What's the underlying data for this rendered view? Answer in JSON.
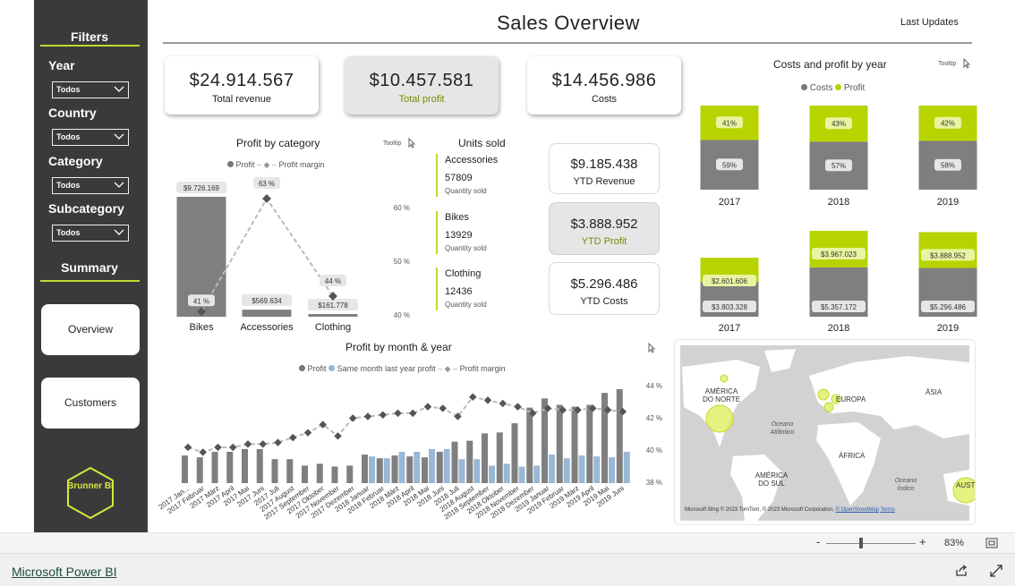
{
  "header": {
    "title": "Sales Overview",
    "last_updates": "Last Updates"
  },
  "sidebar": {
    "filters_title": "Filters",
    "filters": [
      {
        "label": "Year",
        "value": "Todos"
      },
      {
        "label": "Country",
        "value": "Todos"
      },
      {
        "label": "Category",
        "value": "Todos"
      },
      {
        "label": "Subcategory",
        "value": "Todos"
      }
    ],
    "summary_title": "Summary",
    "nav": [
      {
        "label": "Overview"
      },
      {
        "label": "Customers"
      }
    ],
    "logo_text": "Brunner BI"
  },
  "kpis": [
    {
      "value": "$24.914.567",
      "label": "Total revenue"
    },
    {
      "value": "$10.457.581",
      "label": "Total profit"
    },
    {
      "value": "$14.456.986",
      "label": "Costs"
    }
  ],
  "ytd": [
    {
      "value": "$9.185.438",
      "label": "YTD Revenue"
    },
    {
      "value": "$3.888.952",
      "label": "YTD Profit"
    },
    {
      "value": "$5.296.486",
      "label": "YTD Costs"
    }
  ],
  "units_sold": {
    "title": "Units sold",
    "sub_label": "Quantity sold",
    "items": [
      {
        "name": "Accessories",
        "qty": "57809"
      },
      {
        "name": "Bikes",
        "qty": "13929"
      },
      {
        "name": "Clothing",
        "qty": "12436"
      }
    ]
  },
  "tooltip_label": "Tooltip",
  "map": {
    "labels": [
      "AMÉRICA DO NORTE",
      "EUROPA",
      "ÁSIA",
      "Oceano Atlântico",
      "ÁFRICA",
      "AMÉRICA DO SUL",
      "Oceano Índico",
      "AUST"
    ],
    "attribution": "© 2023 TomTom, © 2023 Microsoft Corporation,",
    "osm_link": "© OpenStreetMap",
    "terms_link": "Terms",
    "bing": "Microsoft Bing"
  },
  "footer": {
    "brand": "Microsoft Power BI",
    "zoom_minus": "-",
    "zoom_plus": "+",
    "zoom": "83%"
  },
  "colors": {
    "sidebar": "#3a3a3a",
    "accent": "#c4d82d",
    "grey_bar": "#7f7f7f",
    "blue_bar": "#9ab8d6",
    "profit_green": "#b8d400"
  },
  "chart_data": [
    {
      "type": "bar",
      "title": "Profit by category",
      "legend": [
        "Profit",
        "Profit margin"
      ],
      "legend_position": "top",
      "categories": [
        "Bikes",
        "Accessories",
        "Clothing"
      ],
      "series": [
        {
          "name": "Profit",
          "values": [
            9726169,
            569634,
            161778
          ],
          "labels": [
            "$9.726.169",
            "$569.634",
            "$161.778"
          ]
        },
        {
          "name": "Profit margin",
          "values": [
            41,
            63,
            44
          ],
          "labels": [
            "41 %",
            "63 %",
            "44 %"
          ]
        }
      ],
      "y2_ticks": [
        "60 %",
        "50 %",
        "40 %"
      ],
      "y2lim": [
        40,
        63
      ]
    },
    {
      "type": "bar",
      "title": "Costs and profit by year",
      "subtitle": "percent",
      "legend": [
        "Costs",
        "Profit"
      ],
      "categories": [
        "2017",
        "2018",
        "2019"
      ],
      "series": [
        {
          "name": "Costs",
          "values": [
            59,
            57,
            58
          ],
          "labels": [
            "59%",
            "57%",
            "58%"
          ]
        },
        {
          "name": "Profit",
          "values": [
            41,
            43,
            42
          ],
          "labels": [
            "41%",
            "43%",
            "42%"
          ]
        }
      ]
    },
    {
      "type": "bar",
      "title": "Costs and profit by year",
      "subtitle": "amount",
      "categories": [
        "2017",
        "2018",
        "2019"
      ],
      "series": [
        {
          "name": "Costs",
          "values": [
            3803328,
            5357172,
            5296486
          ],
          "labels": [
            "$3.803.328",
            "$5.357.172",
            "$5.296.486"
          ]
        },
        {
          "name": "Profit",
          "values": [
            2601606,
            3967023,
            3888952
          ],
          "labels": [
            "$2.601.606",
            "$3.967.023",
            "$3.888.952"
          ]
        }
      ]
    },
    {
      "type": "bar",
      "title": "Profit by month & year",
      "legend": [
        "Profit",
        "Same month last year profit",
        "Profit margin"
      ],
      "legend_position": "top",
      "categories": [
        "2017 Jan...",
        "2017 Februar",
        "2017 März",
        "2017 April",
        "2017 Mai",
        "2017 Juni",
        "2017 Juli",
        "2017 August",
        "2017 September",
        "2017 Oktober",
        "2017 November",
        "2017 Dezember",
        "2018 Januar",
        "2018 Februar",
        "2018 März",
        "2018 April",
        "2018 Mai",
        "2018 Juni",
        "2018 Juli",
        "2018 August",
        "2018 September",
        "2018 Oktober",
        "2018 November",
        "2018 Dezember",
        "2019 Januar",
        "2019 Februar",
        "2019 März",
        "2019 April",
        "2019 Mai",
        "2019 Juni"
      ],
      "series": [
        {
          "name": "Profit",
          "values": [
            30,
            28,
            34,
            34,
            37,
            37,
            26,
            26,
            19,
            21,
            18,
            19,
            31,
            27,
            30,
            29,
            28,
            34,
            45,
            46,
            54,
            55,
            65,
            82,
            92,
            85,
            83,
            85,
            98,
            102
          ]
        },
        {
          "name": "Same month last year profit",
          "values": [
            null,
            null,
            null,
            null,
            null,
            null,
            null,
            null,
            null,
            null,
            null,
            null,
            29,
            27,
            34,
            34,
            37,
            37,
            26,
            26,
            19,
            21,
            18,
            19,
            31,
            27,
            30,
            29,
            28,
            34
          ]
        },
        {
          "name": "Profit margin",
          "values": [
            40.2,
            39.9,
            40.2,
            40.2,
            40.4,
            40.4,
            40.5,
            40.8,
            41.1,
            41.6,
            40.9,
            42.0,
            42.1,
            42.2,
            42.3,
            42.3,
            42.7,
            42.6,
            42.1,
            43.3,
            43.1,
            42.9,
            42.7,
            42.3,
            42.6,
            42.5,
            42.5,
            42.6,
            42.5,
            42.4
          ]
        }
      ],
      "y2_ticks": [
        "44 %",
        "42 %",
        "40 %",
        "38 %"
      ],
      "y2lim": [
        38,
        44
      ]
    }
  ]
}
